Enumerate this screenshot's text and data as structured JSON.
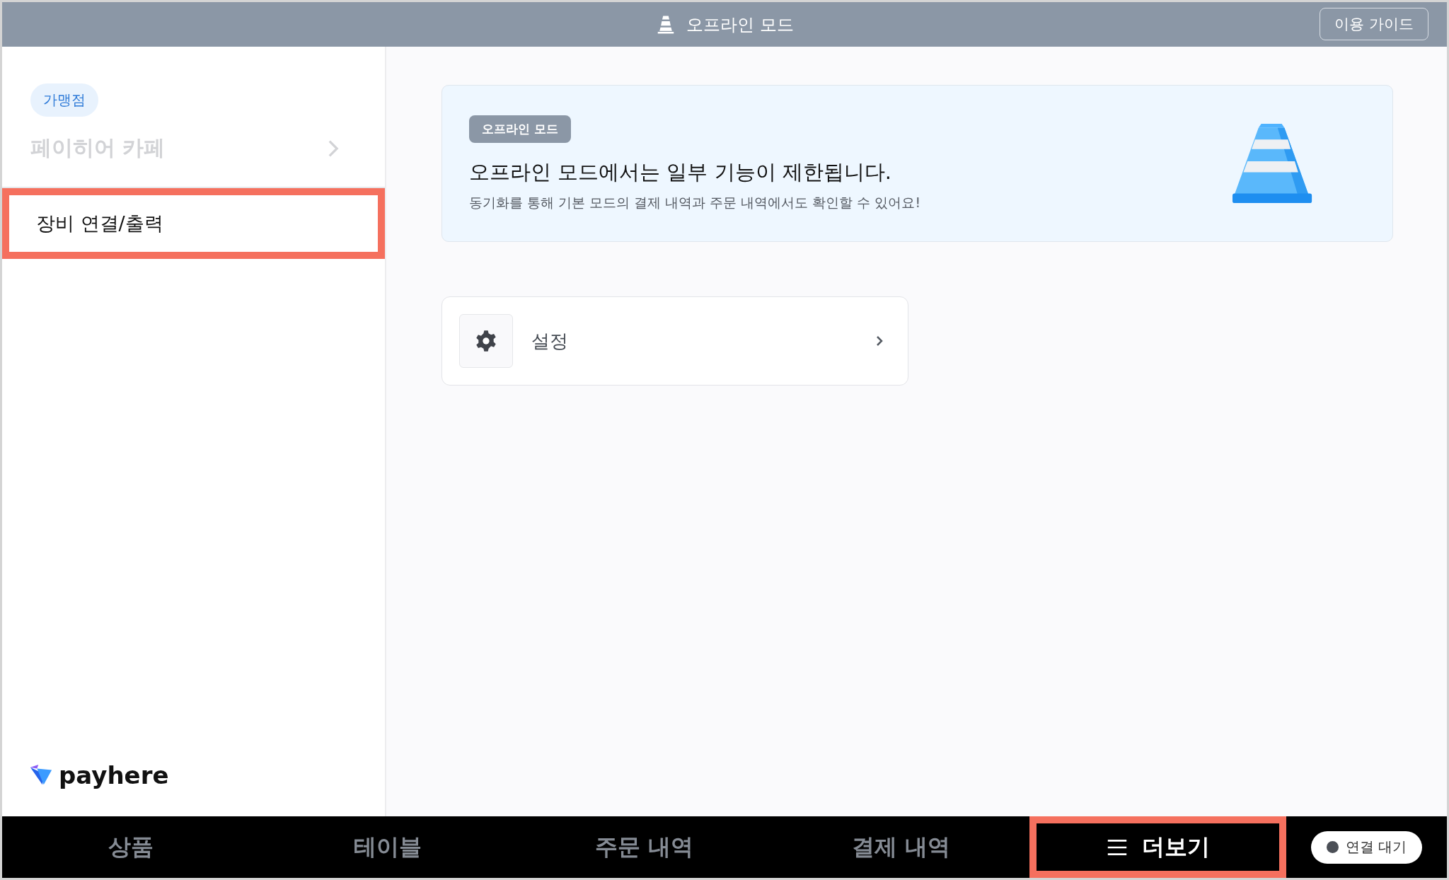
{
  "top_bar": {
    "title": "오프라인 모드",
    "guide_button": "이용 가이드"
  },
  "sidebar": {
    "store_badge": "가맹점",
    "store_name": "페이히어 카페",
    "store_disabled": true,
    "items": [
      {
        "label": "장비 연결/출력",
        "highlighted": true
      }
    ],
    "logo_text": "payhere"
  },
  "banner": {
    "badge": "오프라인 모드",
    "heading": "오프라인 모드에서는 일부 기능이 제한됩니다.",
    "description": "동기화를 통해 기본 모드의 결제 내역과 주문 내역에서도 확인할 수 있어요!"
  },
  "menu_cards": [
    {
      "label": "설정"
    }
  ],
  "bottom_nav": {
    "tabs": [
      {
        "label": "상품",
        "selected": false,
        "highlighted": false
      },
      {
        "label": "테이블",
        "selected": false,
        "highlighted": false
      },
      {
        "label": "주문 내역",
        "selected": false,
        "highlighted": false
      },
      {
        "label": "결제 내역",
        "selected": false,
        "highlighted": false
      },
      {
        "label": "더보기",
        "selected": true,
        "highlighted": true,
        "kind": "menu"
      }
    ],
    "status": {
      "label": "연결 대기",
      "color": "#4b4f56"
    }
  }
}
